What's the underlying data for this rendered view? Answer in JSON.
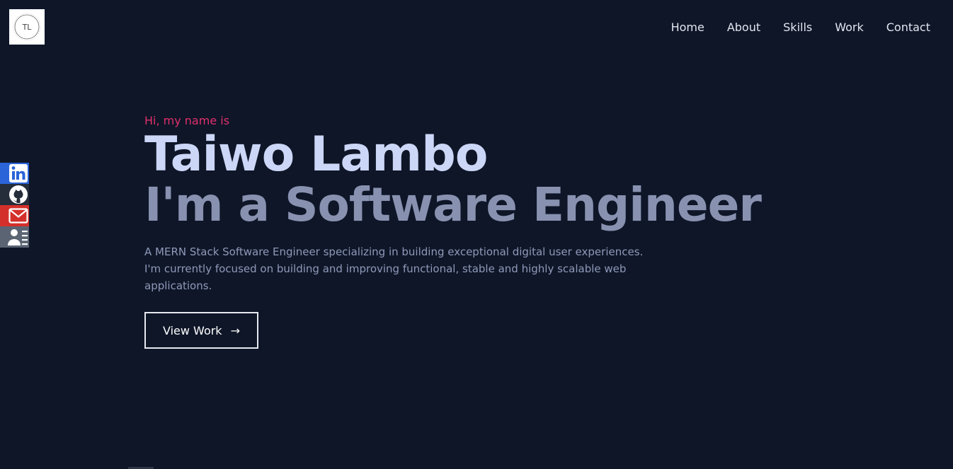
{
  "logo": {
    "text": "TL",
    "icon": "tl-monogram-logo"
  },
  "nav": {
    "items": [
      {
        "label": "Home"
      },
      {
        "label": "About"
      },
      {
        "label": "Skills"
      },
      {
        "label": "Work"
      },
      {
        "label": "Contact"
      }
    ]
  },
  "social": [
    {
      "icon": "linkedin-icon",
      "color": "#2a64d8"
    },
    {
      "icon": "github-icon",
      "color": "#262d3a"
    },
    {
      "icon": "mail-icon",
      "color": "#d4302b"
    },
    {
      "icon": "resume-icon",
      "color": "#5b6473"
    }
  ],
  "hero": {
    "greeting": "Hi, my name is",
    "name": "Taiwo Lambo",
    "role": "I'm a Software Engineer",
    "description": "A MERN Stack Software Engineer specializing in building exceptional digital user experiences. I'm currently focused on building and improving functional, stable and highly scalable web applications.",
    "cta_label": "View Work",
    "cta_icon": "arrow-right-icon"
  },
  "colors": {
    "background": "#0e1628",
    "accent": "#e1306c",
    "name": "#ccd6f6",
    "role": "#8892b0"
  }
}
